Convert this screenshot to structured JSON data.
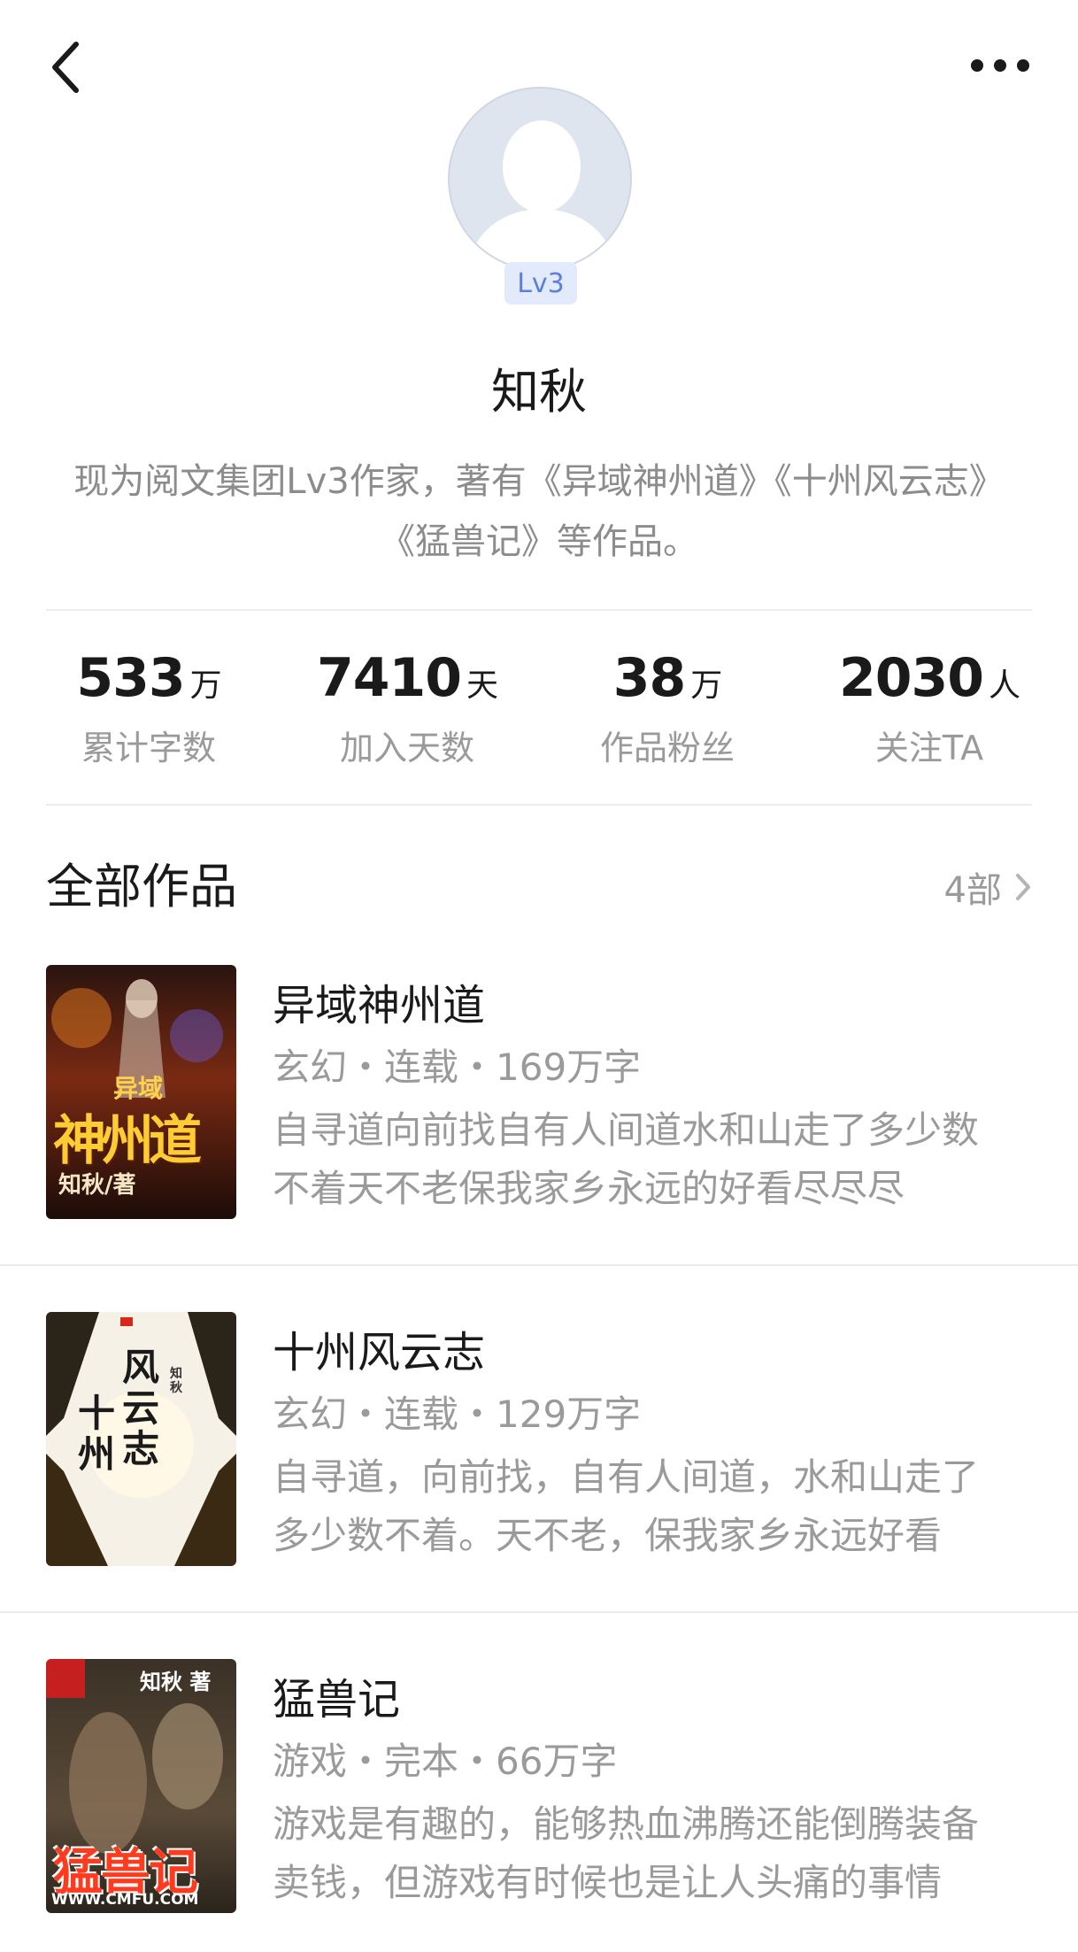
{
  "header": {
    "back_icon": "chevron-left-icon",
    "more_icon": "more-dots-icon"
  },
  "profile": {
    "level": "Lv3",
    "name": "知秋",
    "bio": "现为阅文集团Lv3作家，著有《异域神州道》《十州风云志》《猛兽记》等作品。"
  },
  "stats": [
    {
      "value": "533",
      "unit": "万",
      "label": "累计字数"
    },
    {
      "value": "7410",
      "unit": "天",
      "label": "加入天数"
    },
    {
      "value": "38",
      "unit": "万",
      "label": "作品粉丝"
    },
    {
      "value": "2030",
      "unit": "人",
      "label": "关注TA"
    }
  ],
  "works": {
    "title": "全部作品",
    "count": "4部",
    "books": [
      {
        "title": "异域神州道",
        "meta": "玄幻・连载・169万字",
        "desc": "自寻道向前找自有人间道水和山走了多少数不着天不老保我家乡永远的好看尽尽尽",
        "cover_text_1": "异域",
        "cover_text_2": "神州道",
        "cover_author": "知秋/著"
      },
      {
        "title": "十州风云志",
        "meta": "玄幻・连载・129万字",
        "desc": "自寻道，向前找，自有人间道，水和山走了多少数不着。天不老，保我家乡永远好看",
        "cover_text_1": "风云志",
        "cover_text_2": "十州",
        "cover_author": "知秋"
      },
      {
        "title": "猛兽记",
        "meta": "游戏・完本・66万字",
        "desc": "游戏是有趣的，能够热血沸腾还能倒腾装备卖钱，但游戏有时候也是让人头痛的事情",
        "cover_text_1": "猛兽记",
        "cover_author": "知秋 著",
        "cover_site": "WWW.CMFU.COM"
      }
    ]
  },
  "colors": {
    "accent": "#5a7fdc",
    "muted": "#9a9a9a",
    "divider": "#ececec"
  }
}
